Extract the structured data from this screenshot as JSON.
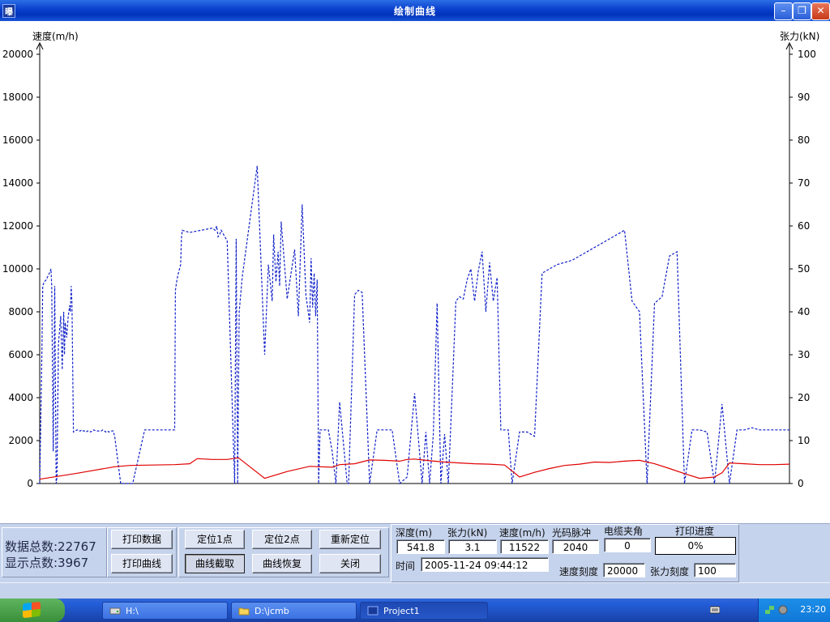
{
  "window": {
    "title": "绘制曲线",
    "app_icon_text": "曝",
    "buttons": {
      "minimize": "–",
      "restore": "❐",
      "close": "✕"
    }
  },
  "chart_data": {
    "type": "line",
    "left_axis_title": "速度(m/h)",
    "right_axis_title": "张力(kN)",
    "ylim_left": [
      0,
      20000
    ],
    "ylim_right": [
      0,
      100
    ],
    "left_ticks": [
      "0",
      "2000",
      "4000",
      "6000",
      "8000",
      "10000",
      "12000",
      "14000",
      "16000",
      "18000",
      "20000"
    ],
    "right_ticks": [
      "0",
      "10",
      "20",
      "30",
      "40",
      "50",
      "60",
      "70",
      "80",
      "90",
      "100"
    ],
    "grid": false,
    "series": [
      {
        "color": "#1020c8",
        "axis": "left",
        "style": "dashed",
        "x": [
          0,
          3,
          4,
          6,
          9,
          10,
          13,
          15,
          16,
          18,
          20,
          22,
          23,
          25,
          28,
          30,
          32,
          33,
          34,
          36,
          38,
          40,
          41,
          42,
          43,
          45,
          47,
          50,
          52,
          54,
          56,
          58,
          60,
          62,
          64,
          66,
          68,
          70,
          72,
          75,
          78,
          80,
          82,
          84,
          86,
          88,
          90,
          92,
          95,
          98,
          100,
          108,
          110,
          112,
          115,
          118,
          121,
          124,
          140,
          160,
          180,
          181,
          183,
          185,
          188,
          189,
          190,
          200,
          230,
          234,
          236,
          238,
          240,
          242,
          250,
          260,
          262,
          264,
          266,
          270,
          290,
          300,
          305,
          310,
          312,
          315,
          318,
          320,
          322,
          330,
          340,
          345,
          350,
          355,
          360,
          362,
          364,
          366,
          368,
          370,
          372,
          374,
          376,
          378,
          380,
          385,
          390,
          395,
          400,
          410,
          412,
          420,
          425,
          430,
          440,
          450,
          460,
          470,
          480,
          490,
          500,
          510,
          515,
          520,
          525,
          530,
          535,
          540,
          545,
          550,
          555,
          560,
          565,
          570,
          575,
          580,
          585,
          590,
          595,
          600,
          605,
          610,
          615,
          620,
          625,
          630,
          640,
          650,
          660,
          670,
          680,
          690,
          700,
          710,
          720,
          730,
          740,
          750,
          760,
          770,
          780,
          790,
          800,
          810,
          820,
          830,
          840,
          850,
          860,
          870,
          880,
          890,
          900,
          910,
          920,
          930,
          940,
          950,
          960,
          970,
          980,
          990,
          1000
        ],
        "y": [
          0,
          6400,
          9200,
          9400,
          9500,
          9600,
          9800,
          10000,
          9200,
          1500,
          9200,
          0,
          300,
          6500,
          7800,
          5300,
          8000,
          6000,
          7500,
          6800,
          7800,
          8300,
          8000,
          9200,
          8400,
          2400,
          2450,
          2500,
          2450,
          2450,
          2500,
          2450,
          2450,
          2400,
          2450,
          2450,
          2400,
          2450,
          2500,
          2450,
          2450,
          2450,
          2450,
          2500,
          2450,
          2400,
          2450,
          2400,
          2450,
          2450,
          2200,
          0,
          0,
          0,
          0,
          0,
          0,
          0,
          2500,
          2500,
          2500,
          9000,
          9500,
          9800,
          10200,
          11400,
          11800,
          11700,
          11900,
          11800,
          12000,
          11500,
          11600,
          11800,
          11300,
          0,
          11400,
          0,
          8000,
          9600,
          14800,
          6000,
          10200,
          8500,
          11600,
          9400,
          10800,
          9200,
          12200,
          8600,
          10900,
          7800,
          13000,
          8800,
          7500,
          10500,
          8200,
          9800,
          7800,
          9500,
          0,
          2500,
          2500,
          2500,
          2500,
          2500,
          1500,
          0,
          3800,
          0,
          0,
          8800,
          9000,
          8900,
          0,
          2500,
          2500,
          2500,
          0,
          300,
          4200,
          0,
          2400,
          0,
          2300,
          8400,
          0,
          2300,
          0,
          4200,
          8500,
          8700,
          8600,
          9500,
          10000,
          8500,
          9900,
          10800,
          8000,
          10300,
          8500,
          9600,
          2500,
          2500,
          2500,
          0,
          2400,
          2400,
          2200,
          9800,
          10000,
          10200,
          10300,
          10400,
          10600,
          10800,
          11000,
          11200,
          11400,
          11600,
          11800,
          8500,
          8000,
          0,
          8400,
          8700,
          10600,
          10800,
          0,
          2500,
          2500,
          2400,
          0,
          3700,
          0,
          2500,
          2500,
          2600,
          2500,
          2500,
          2500,
          2500,
          2500
        ]
      },
      {
        "color": "#e00000",
        "axis": "right",
        "style": "solid",
        "x": [
          0,
          50,
          100,
          120,
          150,
          180,
          200,
          210,
          230,
          250,
          265,
          300,
          330,
          360,
          390,
          400,
          420,
          440,
          460,
          480,
          490,
          500,
          510,
          520,
          540,
          560,
          580,
          600,
          620,
          640,
          660,
          680,
          700,
          720,
          740,
          760,
          780,
          800,
          820,
          840,
          860,
          880,
          900,
          910,
          920,
          940,
          960,
          980,
          1000
        ],
        "y": [
          1.0,
          2.4,
          3.9,
          4.2,
          4.3,
          4.4,
          4.6,
          5.8,
          5.6,
          5.6,
          6.0,
          1.2,
          2.8,
          4.0,
          3.8,
          4.4,
          4.6,
          5.5,
          5.4,
          5.2,
          5.6,
          5.7,
          5.5,
          5.3,
          5.0,
          4.8,
          4.6,
          4.5,
          4.3,
          1.5,
          2.6,
          3.5,
          4.2,
          4.5,
          5.0,
          4.9,
          5.2,
          5.4,
          4.6,
          3.5,
          2.3,
          1.2,
          1.5,
          2.5,
          4.8,
          4.6,
          4.4,
          4.4,
          4.5
        ]
      }
    ]
  },
  "panel": {
    "data_total": "数据总数:22767",
    "display_points": "显示点数:3967",
    "btn_print_data": "打印数据",
    "btn_print_curve": "打印曲线",
    "btn_locate1": "定位1点",
    "btn_locate2": "定位2点",
    "btn_relocate": "重新定位",
    "btn_curve_cut": "曲线截取",
    "btn_curve_restore": "曲线恢复",
    "btn_close": "关闭",
    "lbl_depth": "深度(m)",
    "lbl_tension": "张力(kN)",
    "lbl_speed": "速度(m/h)",
    "lbl_pulse": "光码脉冲",
    "lbl_angle": "电缆夹角",
    "lbl_print_progress": "打印进度",
    "val_depth": "541.8",
    "val_tension": "3.1",
    "val_speed": "11522",
    "val_pulse": "2040",
    "val_angle": "0",
    "val_progress": "0%",
    "lbl_time": "时间",
    "val_time": "2005-11-24 09:44:12",
    "lbl_speed_scale": "速度刻度",
    "val_speed_scale": "20000",
    "lbl_tension_scale": "张力刻度",
    "val_tension_scale": "100"
  },
  "taskbar": {
    "tasks": [
      "H:\\",
      "D:\\jcmb",
      "Project1"
    ],
    "clock": "23:20"
  }
}
